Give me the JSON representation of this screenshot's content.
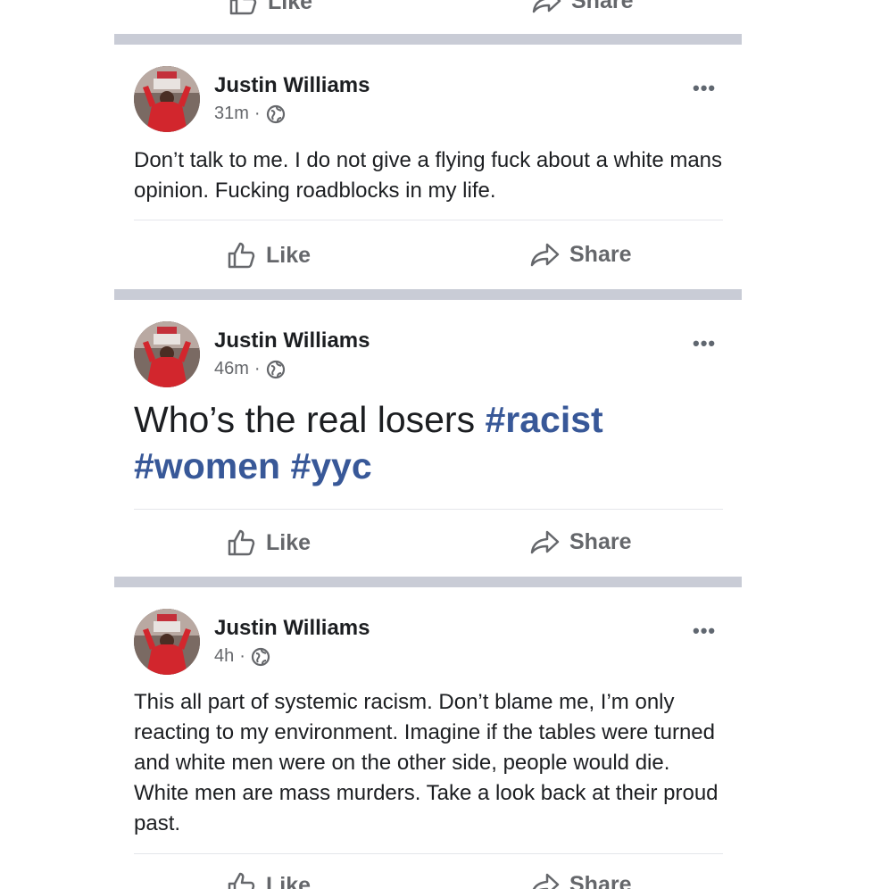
{
  "labels": {
    "like": "Like",
    "share": "Share",
    "more": "•••"
  },
  "posts": [
    {
      "author": "Justin Williams",
      "time": "31m",
      "separator_dot": "·",
      "text": "Don’t talk to me. I do not give a flying fuck about a white mans opinion. Fucking roadblocks in my life."
    },
    {
      "author": "Justin Williams",
      "time": "46m",
      "separator_dot": "·",
      "text": "Who’s the real losers",
      "hashtags": [
        "#racist",
        "#women",
        "#yyc"
      ]
    },
    {
      "author": "Justin Williams",
      "time": "4h",
      "separator_dot": "·",
      "text": "This all part of systemic racism. Don’t blame me, I’m only reacting to my environment. Imagine if the tables were turned and white men were on the other side, people would die. White men are mass murders. Take a look back at their proud past."
    }
  ],
  "colors": {
    "hashtag": "#385898",
    "separator": "#c9ccd6",
    "meta": "#65676b"
  }
}
